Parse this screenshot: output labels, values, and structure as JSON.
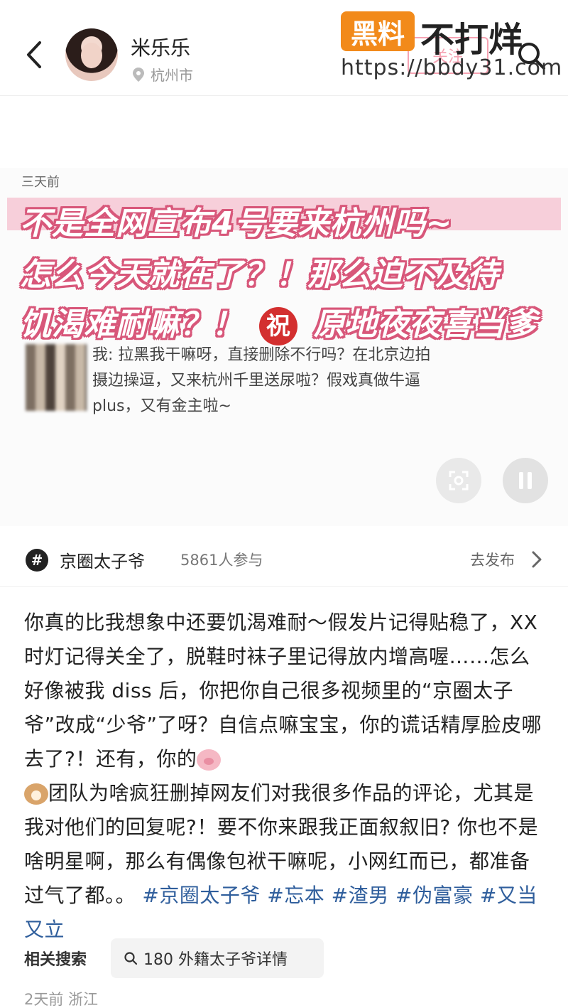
{
  "header": {
    "user_name": "米乐乐",
    "location": "杭州市",
    "follow_label": "关注"
  },
  "watermark": {
    "badge": "黑料",
    "big_text": "不打烊",
    "url": "https://bbdy31.com"
  },
  "post": {
    "time": "三天前",
    "overlay_lines": [
      "不是全网宣布4号要来杭州吗~",
      "怎么今天就在了？！那么迫不及待",
      "饥渴难耐嘛？！",
      "原地夜夜喜当爹"
    ],
    "zhu_badge": "祝",
    "reply_text": "我: 拉黑我干嘛呀，直接删除不行吗？在北京边拍摄边操逗，又来杭州千里送尿啦？假戏真做牛逼plus，又有金主啦~"
  },
  "topic": {
    "icon": "#",
    "name": "京圈太子爷",
    "count": "5861人参与",
    "publish_label": "去发布"
  },
  "content": {
    "part1": "你真的比我想象中还要饥渴难耐～假发片记得贴稳了，XX 时灯记得关全了，脱鞋时袜子里记得放内增高喔……怎么好像被我 diss 后，你把你自己很多视频里的“京圈太子爷”改成“少爷”了呀？自信点嘛宝宝，你的谎话精厚脸皮哪去了?！还有，你的",
    "part2": "团队为啥疯狂删掉网友们对我很多作品的评论，尤其是我对他们的回复呢?！要不你来跟我正面叙叙旧? 你也不是啥明星啊，那么有偶像包袱干嘛呢，小网红而已，都准备过气了都。。",
    "tags": [
      "#京圈太子爷",
      "#忘本",
      "#渣男",
      "#伪富豪",
      "#又当又立"
    ]
  },
  "related": {
    "label": "相关搜索",
    "query": "180 外籍太子爷详情"
  },
  "footer": {
    "meta": "2天前  浙江"
  }
}
